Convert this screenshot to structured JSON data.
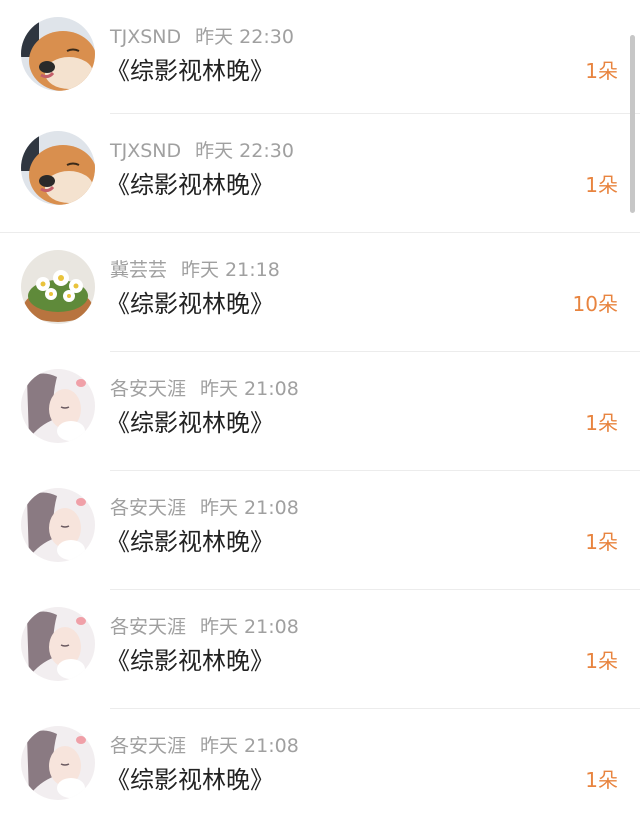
{
  "list": {
    "items": [
      {
        "name": "TJXSND",
        "time": "昨天 22:30",
        "title": "《综影视林晚》",
        "count": "1朵",
        "avatar": "shiba-dog-avatar"
      },
      {
        "name": "TJXSND",
        "time": "昨天 22:30",
        "title": "《综影视林晚》",
        "count": "1朵",
        "avatar": "shiba-dog-avatar"
      },
      {
        "name": "冀芸芸",
        "time": "昨天 21:18",
        "title": "《综影视林晚》",
        "count": "10朵",
        "avatar": "daisy-flowers-avatar"
      },
      {
        "name": "各安天涯",
        "time": "昨天 21:08",
        "title": "《综影视林晚》",
        "count": "1朵",
        "avatar": "anime-girl-avatar"
      },
      {
        "name": "各安天涯",
        "time": "昨天 21:08",
        "title": "《综影视林晚》",
        "count": "1朵",
        "avatar": "anime-girl-avatar"
      },
      {
        "name": "各安天涯",
        "time": "昨天 21:08",
        "title": "《综影视林晚》",
        "count": "1朵",
        "avatar": "anime-girl-avatar"
      },
      {
        "name": "各安天涯",
        "time": "昨天 21:08",
        "title": "《综影视林晚》",
        "count": "1朵",
        "avatar": "anime-girl-avatar"
      }
    ]
  },
  "colors": {
    "count_accent": "#e8843f",
    "meta_gray": "#a0a0a0",
    "title_text": "#222222"
  }
}
